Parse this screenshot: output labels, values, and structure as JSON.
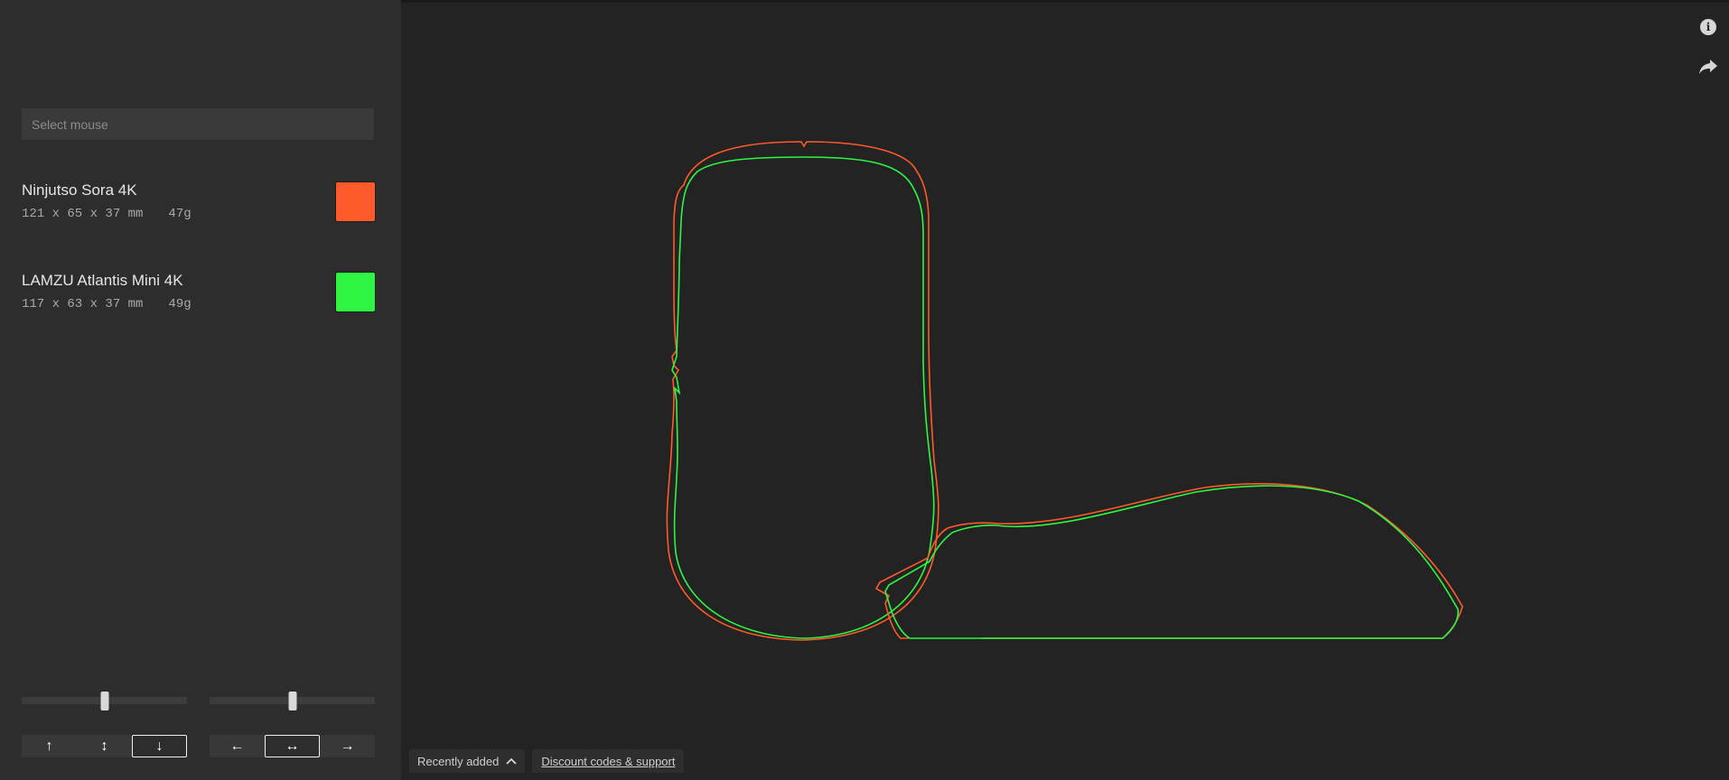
{
  "search": {
    "placeholder": "Select mouse"
  },
  "mice": [
    {
      "name": "Ninjutso Sora 4K",
      "dims": "121 x 65 x 37 mm",
      "weight": "47g",
      "color": "#ff5a2a"
    },
    {
      "name": "LAMZU Atlantis Mini 4K",
      "dims": "117 x 63 x 37 mm",
      "weight": "49g",
      "color": "#2ef542"
    }
  ],
  "controls": {
    "vertical_slider_value": 0.5,
    "horizontal_slider_value": 0.5,
    "vertical_buttons": [
      "↑",
      "↕",
      "↓"
    ],
    "vertical_active": 2,
    "horizontal_buttons": [
      "←",
      "↔",
      "→"
    ],
    "horizontal_active": 1
  },
  "icons": {
    "info": "info-icon",
    "share": "share-icon",
    "info_glyph": "i"
  },
  "footer": {
    "recent_label": "Recently added",
    "recent_icon": "chevron-up-icon",
    "discount_label": "Discount codes & support"
  }
}
